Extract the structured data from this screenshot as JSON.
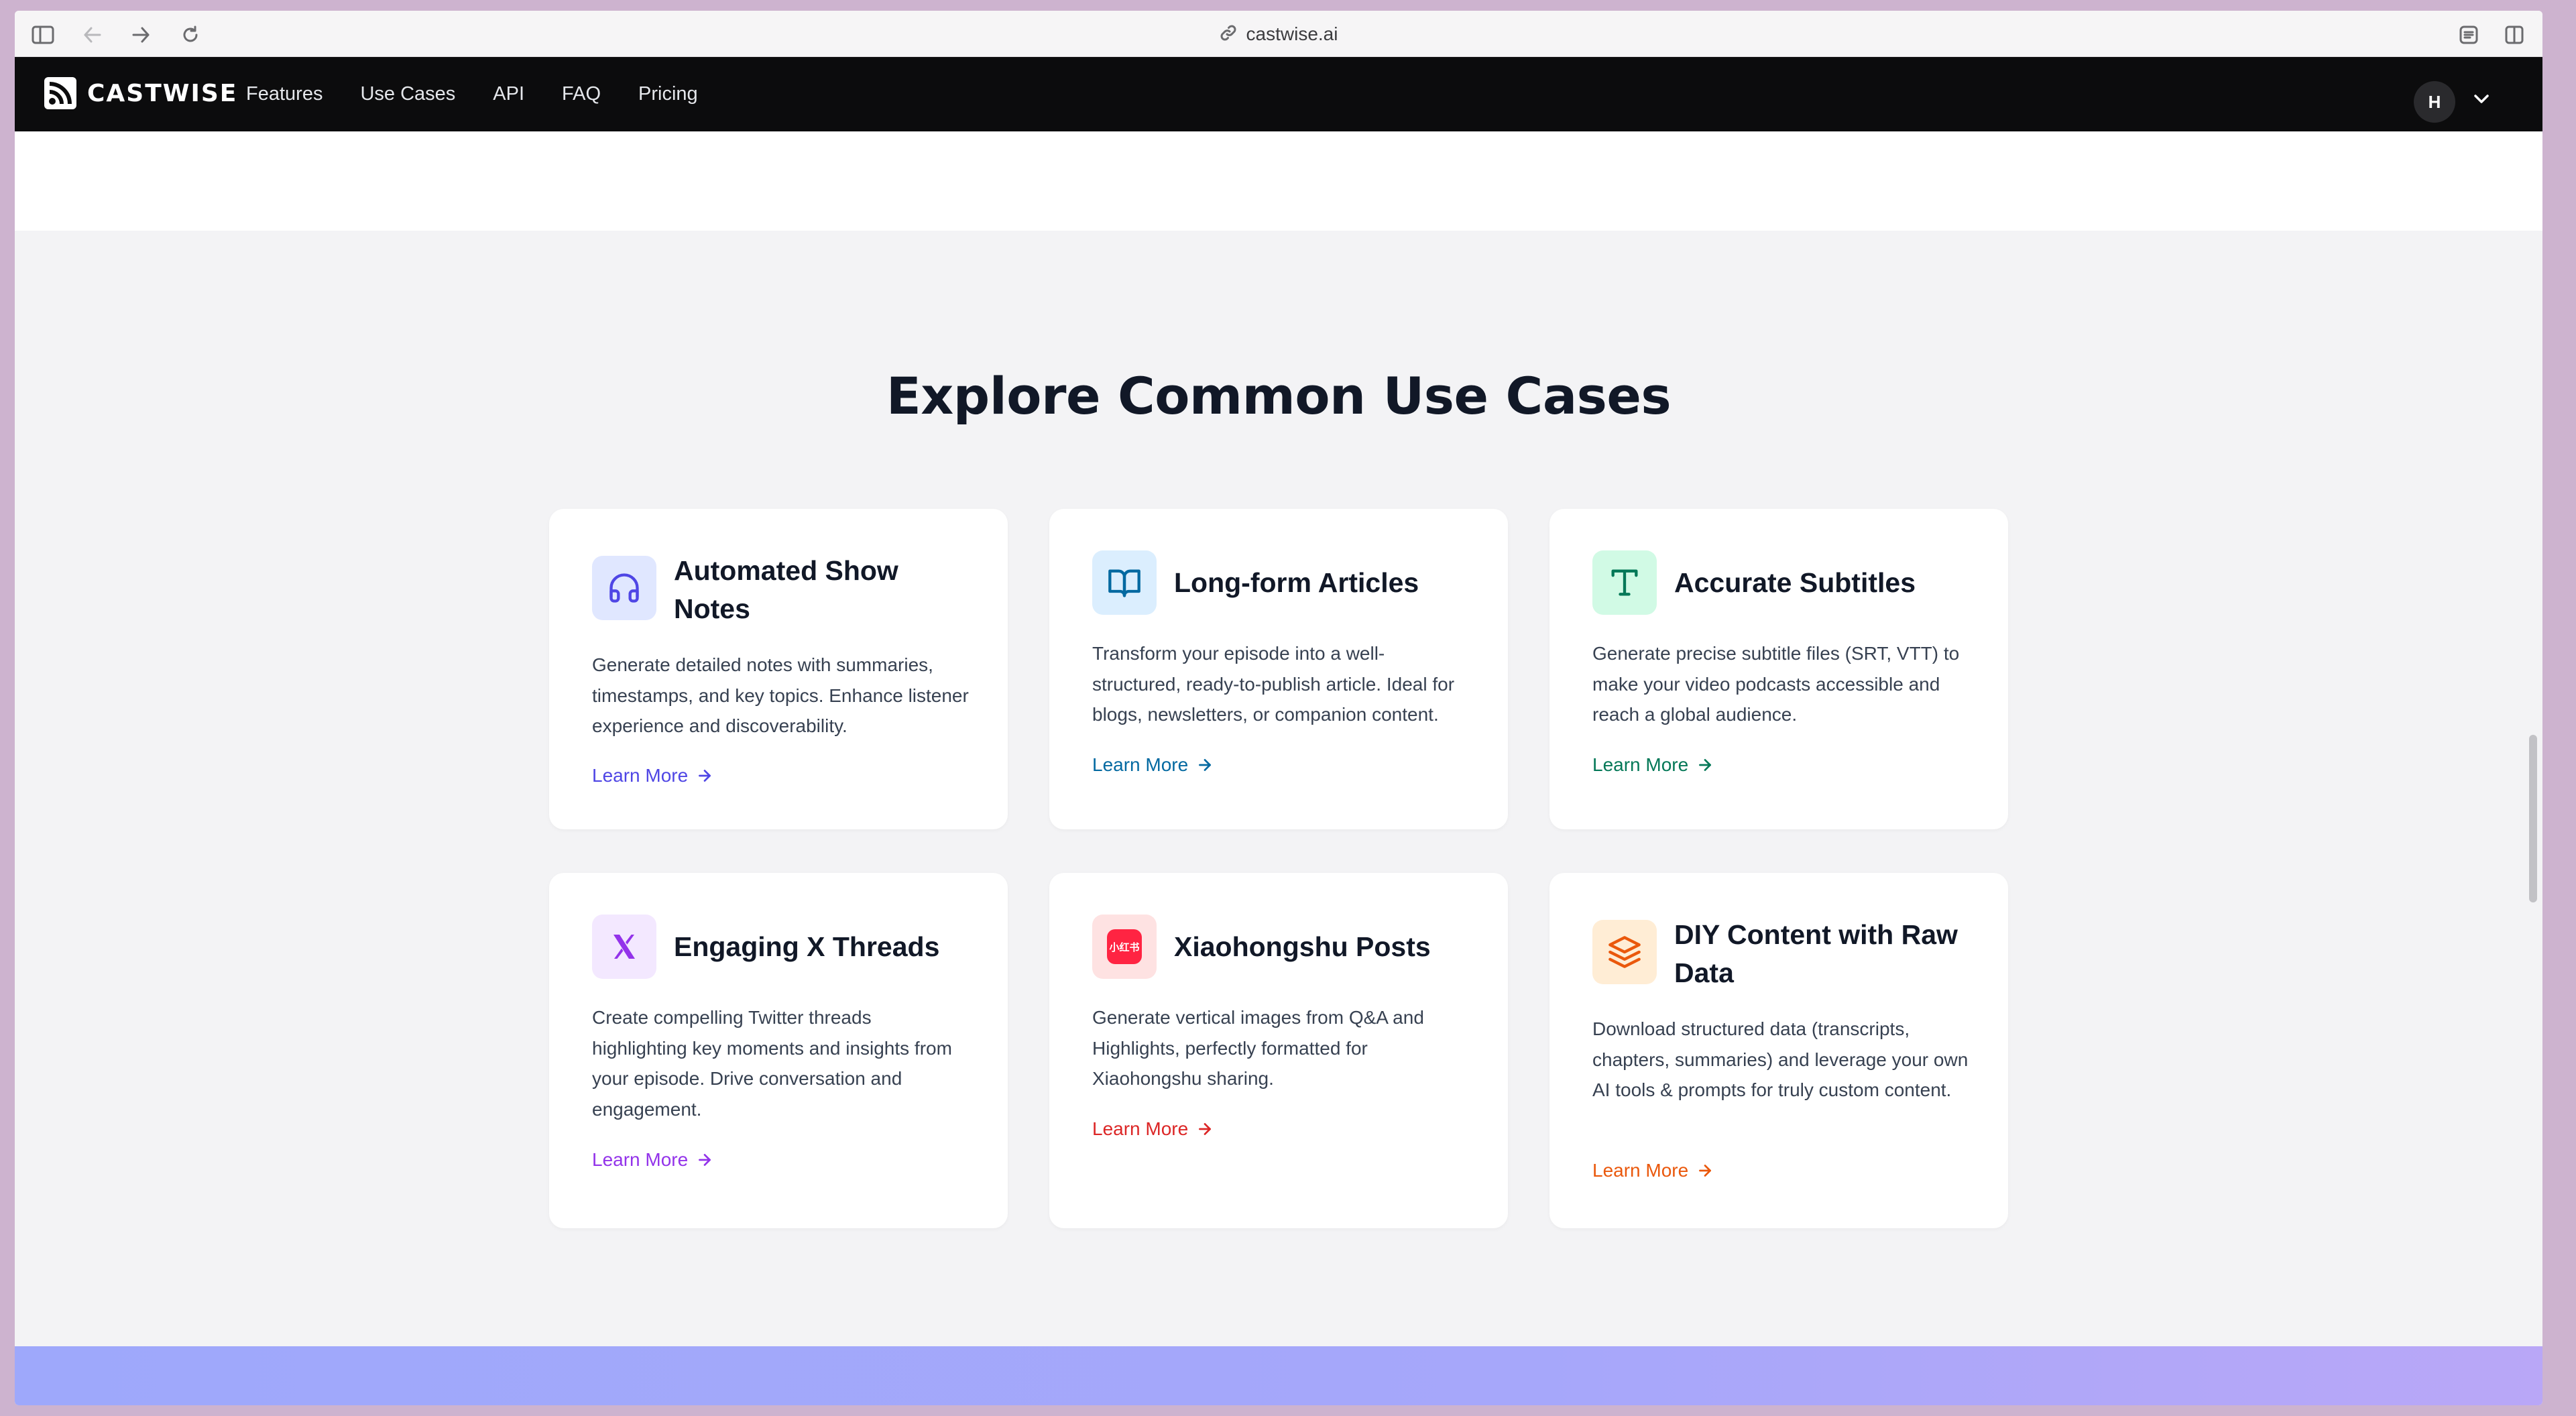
{
  "browser": {
    "url": "castwise.ai"
  },
  "nav": {
    "brand": "CASTWISE",
    "links": [
      "Features",
      "Use Cases",
      "API",
      "FAQ",
      "Pricing"
    ],
    "avatar_initial": "H"
  },
  "section": {
    "title": "Explore Common Use Cases"
  },
  "cards": [
    {
      "title": "Automated Show Notes",
      "description": "Generate detailed notes with summaries, timestamps, and key topics. Enhance listener experience and discoverability.",
      "link": "Learn More",
      "icon": "headphones-icon",
      "accent": "#4f46e5",
      "icon_bg": "#e0e7ff"
    },
    {
      "title": "Long-form Articles",
      "description": "Transform your episode into a well-structured, ready-to-publish article. Ideal for blogs, newsletters, or companion content.",
      "link": "Learn More",
      "icon": "book-open-icon",
      "accent": "#0369a1",
      "icon_bg": "#dbeefe"
    },
    {
      "title": "Accurate Subtitles",
      "description": "Generate precise subtitle files (SRT, VTT) to make your video podcasts accessible and reach a global audience.",
      "link": "Learn More",
      "icon": "type-icon",
      "accent": "#047857",
      "icon_bg": "#d1fae5"
    },
    {
      "title": "Engaging X Threads",
      "description": "Create compelling Twitter threads highlighting key moments and insights from your episode. Drive conversation and engagement.",
      "link": "Learn More",
      "icon": "x-logo-icon",
      "accent": "#9333ea",
      "icon_bg": "#f3e8ff"
    },
    {
      "title": "Xiaohongshu Posts",
      "description": "Generate vertical images from Q&A and Highlights, perfectly formatted for Xiaohongshu sharing.",
      "link": "Learn More",
      "icon": "xiaohongshu-logo-icon",
      "icon_text": "小红书",
      "accent": "#dc2626",
      "icon_bg": "#fee2e2"
    },
    {
      "title": "DIY Content with Raw Data",
      "description": "Download structured data (transcripts, chapters, summaries) and leverage your own AI tools & prompts for truly custom content.",
      "link": "Learn More",
      "icon": "layers-icon",
      "accent": "#ea580c",
      "icon_bg": "#ffedd5"
    }
  ]
}
